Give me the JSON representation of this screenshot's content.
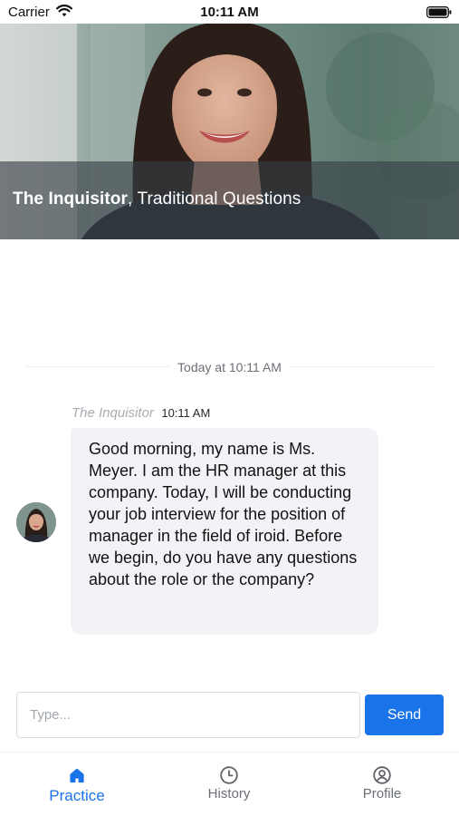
{
  "status_bar": {
    "carrier": "Carrier",
    "time": "10:11 AM",
    "wifi_icon": "wifi-icon",
    "battery_icon": "battery-icon"
  },
  "hero": {
    "interviewer_name": "The Inquisitor",
    "separator": ",",
    "interview_type": "Traditional Questions"
  },
  "chat": {
    "day_divider": "Today at 10:11 AM",
    "messages": [
      {
        "sender": "The Inquisitor",
        "time": "10:11 AM",
        "text": "Good morning, my name is Ms. Meyer. I am the HR manager at this company. Today, I will be conducting your job interview for the position of manager in the field of iroid. Before we begin, do you have any questions about the role or the company?"
      }
    ]
  },
  "composer": {
    "placeholder": "Type...",
    "value": "",
    "send_label": "Send"
  },
  "tabs": [
    {
      "label": "Practice",
      "icon": "home-icon",
      "active": true
    },
    {
      "label": "History",
      "icon": "clock-icon",
      "active": false
    },
    {
      "label": "Profile",
      "icon": "user-circle-icon",
      "active": false
    }
  ],
  "colors": {
    "accent": "#1a73e8",
    "bubble": "#f1f3f6",
    "hero_overlay": "#373e46",
    "muted_text": "#6b6f76"
  }
}
